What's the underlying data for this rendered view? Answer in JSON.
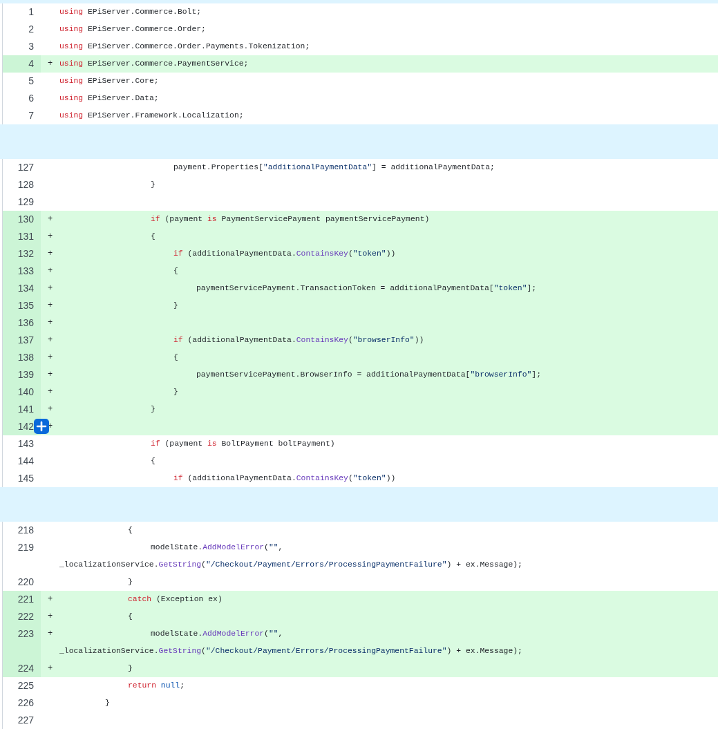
{
  "rows": [
    {
      "kind": "separator-edge"
    },
    {
      "kind": "line",
      "number": "1",
      "added": false,
      "tokens": [
        {
          "kind": "keyword",
          "text": "using"
        },
        {
          "kind": "text",
          "text": " EPiServer.Commerce.Bolt;"
        }
      ]
    },
    {
      "kind": "line",
      "number": "2",
      "added": false,
      "tokens": [
        {
          "kind": "keyword",
          "text": "using"
        },
        {
          "kind": "text",
          "text": " EPiServer.Commerce.Order;"
        }
      ]
    },
    {
      "kind": "line",
      "number": "3",
      "added": false,
      "tokens": [
        {
          "kind": "keyword",
          "text": "using"
        },
        {
          "kind": "text",
          "text": " EPiServer.Commerce.Order.Payments.Tokenization;"
        }
      ]
    },
    {
      "kind": "line",
      "number": "4",
      "added": true,
      "marker": "+",
      "tokens": [
        {
          "kind": "keyword",
          "text": "using"
        },
        {
          "kind": "text",
          "text": " EPiServer.Commerce.PaymentService;"
        }
      ]
    },
    {
      "kind": "line",
      "number": "5",
      "added": false,
      "tokens": [
        {
          "kind": "keyword",
          "text": "using"
        },
        {
          "kind": "text",
          "text": " EPiServer.Core;"
        }
      ]
    },
    {
      "kind": "line",
      "number": "6",
      "added": false,
      "tokens": [
        {
          "kind": "keyword",
          "text": "using"
        },
        {
          "kind": "text",
          "text": " EPiServer.Data;"
        }
      ]
    },
    {
      "kind": "line",
      "number": "7",
      "added": false,
      "tokens": [
        {
          "kind": "keyword",
          "text": "using"
        },
        {
          "kind": "text",
          "text": " EPiServer.Framework.Localization;"
        }
      ]
    },
    {
      "kind": "separator"
    },
    {
      "kind": "line",
      "number": "127",
      "added": false,
      "tokens": [
        {
          "kind": "text",
          "text": "\t\t\t\t\tpayment.Properties["
        },
        {
          "kind": "string",
          "text": "\"additionalPaymentData\""
        },
        {
          "kind": "text",
          "text": "] = additionalPaymentData;"
        }
      ]
    },
    {
      "kind": "line",
      "number": "128",
      "added": false,
      "tokens": [
        {
          "kind": "text",
          "text": "\t\t\t\t}"
        }
      ]
    },
    {
      "kind": "line",
      "number": "129",
      "added": false,
      "tokens": []
    },
    {
      "kind": "line",
      "number": "130",
      "added": true,
      "marker": "+",
      "tokens": [
        {
          "kind": "keyword",
          "text": "\t\t\t\tif"
        },
        {
          "kind": "text",
          "text": " (payment "
        },
        {
          "kind": "keyword",
          "text": "is"
        },
        {
          "kind": "text",
          "text": " PaymentServicePayment paymentServicePayment)"
        }
      ]
    },
    {
      "kind": "line",
      "number": "131",
      "added": true,
      "marker": "+",
      "tokens": [
        {
          "kind": "text",
          "text": "\t\t\t\t{"
        }
      ]
    },
    {
      "kind": "line",
      "number": "132",
      "added": true,
      "marker": "+",
      "tokens": [
        {
          "kind": "keyword",
          "text": "\t\t\t\t\tif"
        },
        {
          "kind": "text",
          "text": " (additionalPaymentData."
        },
        {
          "kind": "method",
          "text": "ContainsKey"
        },
        {
          "kind": "text",
          "text": "("
        },
        {
          "kind": "string",
          "text": "\"token\""
        },
        {
          "kind": "text",
          "text": "))"
        }
      ]
    },
    {
      "kind": "line",
      "number": "133",
      "added": true,
      "marker": "+",
      "tokens": [
        {
          "kind": "text",
          "text": "\t\t\t\t\t{"
        }
      ]
    },
    {
      "kind": "line",
      "number": "134",
      "added": true,
      "marker": "+",
      "tokens": [
        {
          "kind": "text",
          "text": "\t\t\t\t\t\tpaymentServicePayment.TransactionToken = additionalPaymentData["
        },
        {
          "kind": "string",
          "text": "\"token\""
        },
        {
          "kind": "text",
          "text": "];"
        }
      ]
    },
    {
      "kind": "line",
      "number": "135",
      "added": true,
      "marker": "+",
      "tokens": [
        {
          "kind": "text",
          "text": "\t\t\t\t\t}"
        }
      ]
    },
    {
      "kind": "line",
      "number": "136",
      "added": true,
      "marker": "+",
      "tokens": []
    },
    {
      "kind": "line",
      "number": "137",
      "added": true,
      "marker": "+",
      "tokens": [
        {
          "kind": "keyword",
          "text": "\t\t\t\t\tif"
        },
        {
          "kind": "text",
          "text": " (additionalPaymentData."
        },
        {
          "kind": "method",
          "text": "ContainsKey"
        },
        {
          "kind": "text",
          "text": "("
        },
        {
          "kind": "string",
          "text": "\"browserInfo\""
        },
        {
          "kind": "text",
          "text": "))"
        }
      ]
    },
    {
      "kind": "line",
      "number": "138",
      "added": true,
      "marker": "+",
      "tokens": [
        {
          "kind": "text",
          "text": "\t\t\t\t\t{"
        }
      ]
    },
    {
      "kind": "line",
      "number": "139",
      "added": true,
      "marker": "+",
      "tokens": [
        {
          "kind": "text",
          "text": "\t\t\t\t\t\tpaymentServicePayment.BrowserInfo = additionalPaymentData["
        },
        {
          "kind": "string",
          "text": "\"browserInfo\""
        },
        {
          "kind": "text",
          "text": "];"
        }
      ]
    },
    {
      "kind": "line",
      "number": "140",
      "added": true,
      "marker": "+",
      "tokens": [
        {
          "kind": "text",
          "text": "\t\t\t\t\t}"
        }
      ]
    },
    {
      "kind": "line",
      "number": "141",
      "added": true,
      "marker": "+",
      "tokens": [
        {
          "kind": "text",
          "text": "\t\t\t\t}"
        }
      ]
    },
    {
      "kind": "line",
      "number": "142",
      "added": true,
      "marker": "+",
      "comment_button": true,
      "tokens": []
    },
    {
      "kind": "line",
      "number": "143",
      "added": false,
      "tokens": [
        {
          "kind": "keyword",
          "text": "\t\t\t\tif"
        },
        {
          "kind": "text",
          "text": " (payment "
        },
        {
          "kind": "keyword",
          "text": "is"
        },
        {
          "kind": "text",
          "text": " BoltPayment boltPayment)"
        }
      ]
    },
    {
      "kind": "line",
      "number": "144",
      "added": false,
      "tokens": [
        {
          "kind": "text",
          "text": "\t\t\t\t{"
        }
      ]
    },
    {
      "kind": "line",
      "number": "145",
      "added": false,
      "tokens": [
        {
          "kind": "keyword",
          "text": "\t\t\t\t\tif"
        },
        {
          "kind": "text",
          "text": " (additionalPaymentData."
        },
        {
          "kind": "method",
          "text": "ContainsKey"
        },
        {
          "kind": "text",
          "text": "("
        },
        {
          "kind": "string",
          "text": "\"token\""
        },
        {
          "kind": "text",
          "text": "))"
        }
      ]
    },
    {
      "kind": "separator"
    },
    {
      "kind": "line",
      "number": "218",
      "added": false,
      "tokens": [
        {
          "kind": "text",
          "text": "\t\t\t{"
        }
      ]
    },
    {
      "kind": "line",
      "number": "219",
      "added": false,
      "tokens": [
        {
          "kind": "text",
          "text": "\t\t\t\tmodelState."
        },
        {
          "kind": "method",
          "text": "AddModelError"
        },
        {
          "kind": "text",
          "text": "("
        },
        {
          "kind": "string",
          "text": "\"\""
        },
        {
          "kind": "text",
          "text": ", "
        },
        {
          "kind": "text",
          "wrap": true,
          "text": "_localizationService."
        },
        {
          "kind": "method",
          "text": "GetString"
        },
        {
          "kind": "text",
          "text": "("
        },
        {
          "kind": "string",
          "text": "\"/Checkout/Payment/Errors/ProcessingPaymentFailure\""
        },
        {
          "kind": "text",
          "text": ") + ex.Message);"
        }
      ]
    },
    {
      "kind": "line",
      "number": "220",
      "added": false,
      "tokens": [
        {
          "kind": "text",
          "text": "\t\t\t}"
        }
      ]
    },
    {
      "kind": "line",
      "number": "221",
      "added": true,
      "marker": "+",
      "tokens": [
        {
          "kind": "keyword",
          "text": "\t\t\tcatch"
        },
        {
          "kind": "text",
          "text": " (Exception ex)"
        }
      ]
    },
    {
      "kind": "line",
      "number": "222",
      "added": true,
      "marker": "+",
      "tokens": [
        {
          "kind": "text",
          "text": "\t\t\t{"
        }
      ]
    },
    {
      "kind": "line",
      "number": "223",
      "added": true,
      "marker": "+",
      "tokens": [
        {
          "kind": "text",
          "text": "\t\t\t\tmodelState."
        },
        {
          "kind": "method",
          "text": "AddModelError"
        },
        {
          "kind": "text",
          "text": "("
        },
        {
          "kind": "string",
          "text": "\"\""
        },
        {
          "kind": "text",
          "text": ", "
        },
        {
          "kind": "text",
          "wrap": true,
          "text": "_localizationService."
        },
        {
          "kind": "method",
          "text": "GetString"
        },
        {
          "kind": "text",
          "text": "("
        },
        {
          "kind": "string",
          "text": "\"/Checkout/Payment/Errors/ProcessingPaymentFailure\""
        },
        {
          "kind": "text",
          "text": ") + ex.Message);"
        }
      ]
    },
    {
      "kind": "line",
      "number": "224",
      "added": true,
      "marker": "+",
      "tokens": [
        {
          "kind": "text",
          "text": "\t\t\t}"
        }
      ]
    },
    {
      "kind": "line",
      "number": "225",
      "added": false,
      "tokens": [
        {
          "kind": "keyword",
          "text": "\t\t\treturn "
        },
        {
          "kind": "literal",
          "text": "null"
        },
        {
          "kind": "text",
          "text": ";"
        }
      ]
    },
    {
      "kind": "line",
      "number": "226",
      "added": false,
      "tokens": [
        {
          "kind": "text",
          "text": "\t\t}"
        }
      ]
    },
    {
      "kind": "line",
      "number": "227",
      "added": false,
      "tokens": []
    }
  ]
}
